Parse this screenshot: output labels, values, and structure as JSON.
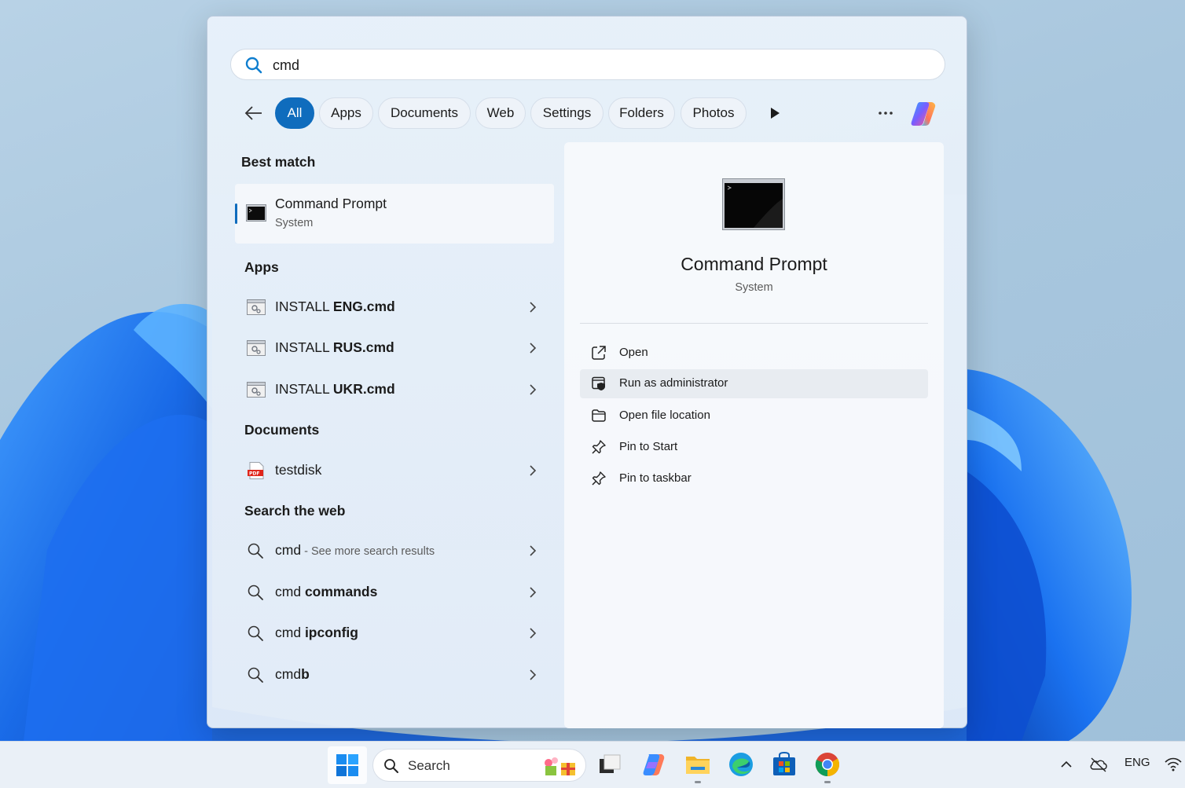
{
  "search": {
    "query": "cmd"
  },
  "filters": {
    "chips": [
      "All",
      "Apps",
      "Documents",
      "Web",
      "Settings",
      "Folders",
      "Photos"
    ],
    "active": "All"
  },
  "best_match": {
    "heading": "Best match",
    "title": "Command Prompt",
    "subtitle": "System"
  },
  "apps": {
    "heading": "Apps",
    "items": [
      {
        "prefix": "INSTALL ",
        "bold": "ENG.cmd"
      },
      {
        "prefix": "INSTALL ",
        "bold": "RUS.cmd"
      },
      {
        "prefix": "INSTALL ",
        "bold": "UKR.cmd"
      }
    ]
  },
  "documents": {
    "heading": "Documents",
    "items": [
      {
        "label": "testdisk",
        "icon": "pdf-icon"
      }
    ]
  },
  "web": {
    "heading": "Search the web",
    "items": [
      {
        "prefix": "cmd",
        "bold": "",
        "hint": " - See more search results"
      },
      {
        "prefix": "cmd ",
        "bold": "commands",
        "hint": ""
      },
      {
        "prefix": "cmd ",
        "bold": "ipconfig",
        "hint": ""
      },
      {
        "prefix": "cmd",
        "bold": "b",
        "hint": ""
      }
    ]
  },
  "preview": {
    "title": "Command Prompt",
    "subtitle": "System",
    "actions": [
      {
        "label": "Open",
        "icon": "open-external-icon"
      },
      {
        "label": "Run as administrator",
        "icon": "shield-window-icon"
      },
      {
        "label": "Open file location",
        "icon": "folder-icon"
      },
      {
        "label": "Pin to Start",
        "icon": "pin-icon"
      },
      {
        "label": "Pin to taskbar",
        "icon": "pin-icon"
      }
    ],
    "highlighted_action": "Run as administrator"
  },
  "taskbar": {
    "search_label": "Search",
    "language": "ENG"
  },
  "colors": {
    "accent": "#0f6cbd"
  }
}
